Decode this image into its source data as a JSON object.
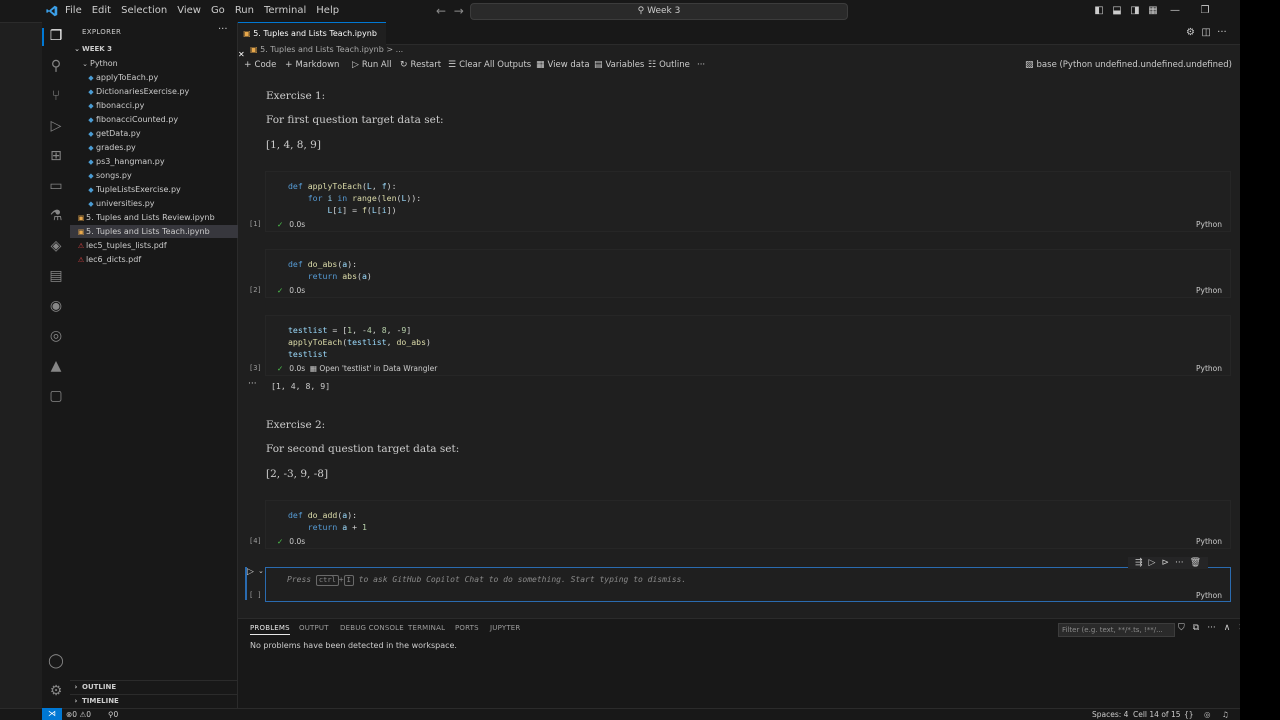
{
  "titlebar": {
    "menu": [
      "File",
      "Edit",
      "Selection",
      "View",
      "Go",
      "Run",
      "Terminal",
      "Help"
    ],
    "search": "Week 3"
  },
  "sidebar": {
    "title": "EXPLORER",
    "root": "WEEK 3",
    "folder": "Python",
    "files": [
      "applyToEach.py",
      "DictionariesExercise.py",
      "fibonacci.py",
      "fibonacciCounted.py",
      "getData.py",
      "grades.py",
      "ps3_hangman.py",
      "songs.py",
      "TupleListsExercise.py",
      "universities.py"
    ],
    "root_files": [
      "5. Tuples and Lists Review.ipynb",
      "5. Tuples and Lists Teach.ipynb",
      "lec5_tuples_lists.pdf",
      "lec6_dicts.pdf"
    ],
    "outline": "OUTLINE",
    "timeline": "TIMELINE"
  },
  "editor": {
    "tab": "5. Tuples and Lists Teach.ipynb",
    "breadcrumb": "5. Tuples and Lists Teach.ipynb > ...",
    "toolbar": {
      "code": "Code",
      "markdown": "Markdown",
      "run_all": "Run All",
      "restart": "Restart",
      "clear": "Clear All Outputs",
      "view_data": "View data",
      "variables": "Variables",
      "outline": "Outline",
      "more": "···",
      "kernel": "base (Python undefined.undefined.undefined)"
    }
  },
  "notebook": {
    "ex1_title": "Exercise 1:",
    "ex1_desc": "For first question target data set:",
    "ex1_data": "[1, 4, 8, 9]",
    "cell1": {
      "count": "[1]",
      "time": "0.0s",
      "lang": "Python"
    },
    "cell2": {
      "count": "[2]",
      "time": "0.0s",
      "lang": "Python"
    },
    "cell3": {
      "count": "[3]",
      "time": "0.0s",
      "wrangler": "Open 'testlist' in Data Wrangler",
      "lang": "Python",
      "output": "[1, 4, 8, 9]"
    },
    "ex2_title": "Exercise 2:",
    "ex2_desc": "For second question target data set:",
    "ex2_data": "[2, -3, 9, -8]",
    "cell4": {
      "count": "[4]",
      "time": "0.0s",
      "lang": "Python"
    },
    "cell5": {
      "count": "[ ]",
      "lang": "Python",
      "hint_pre": "Press",
      "key1": "ctrl",
      "plus": "+",
      "key2": "I",
      "hint_post": "to ask GitHub Copilot Chat to do something. Start typing to dismiss."
    }
  },
  "panel": {
    "tabs": [
      "PROBLEMS",
      "OUTPUT",
      "DEBUG CONSOLE",
      "TERMINAL",
      "PORTS",
      "JUPYTER"
    ],
    "filter_placeholder": "Filter (e.g. text, **/*.ts, !**/...",
    "message": "No problems have been detected in the workspace."
  },
  "statusbar": {
    "errors": "0",
    "warnings": "0",
    "ports": "0",
    "spaces": "Spaces: 4",
    "cell": "Cell 14 of 15"
  },
  "colors": {
    "accent": "#0078d4",
    "keyword": "#569cd6",
    "function": "#dcdcaa",
    "number": "#b5cea8",
    "success": "#4ec94e"
  }
}
